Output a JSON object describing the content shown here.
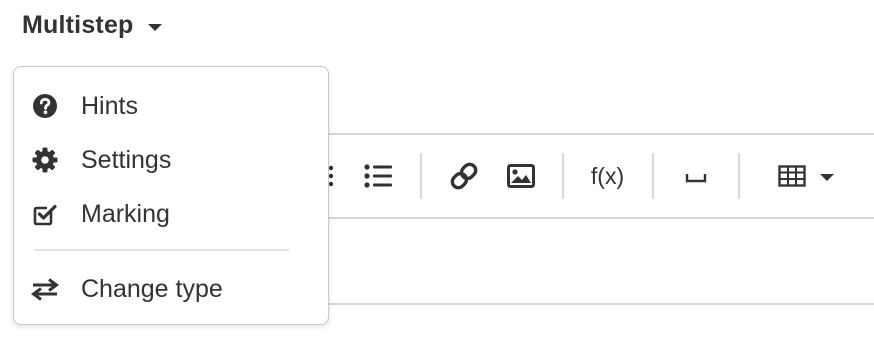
{
  "header": {
    "title": "Multistep",
    "dropdown_icon": "caret-down-icon"
  },
  "menu": {
    "items": [
      {
        "label": "Hints",
        "icon": "question-circle-icon"
      },
      {
        "label": "Settings",
        "icon": "gear-icon"
      },
      {
        "label": "Marking",
        "icon": "check-square-icon"
      },
      {
        "label": "Change type",
        "icon": "exchange-arrows-icon"
      }
    ]
  },
  "toolbar": {
    "buttons": [
      {
        "icon": "list-icon"
      },
      {
        "icon": "link-icon"
      },
      {
        "icon": "image-icon"
      },
      {
        "label": "f(x)"
      },
      {
        "label": "⎵"
      },
      {
        "icon": "table-icon"
      }
    ]
  },
  "colors": {
    "text": "#333333",
    "border": "#d6d6d6",
    "menu_border": "#c9c9c9"
  }
}
